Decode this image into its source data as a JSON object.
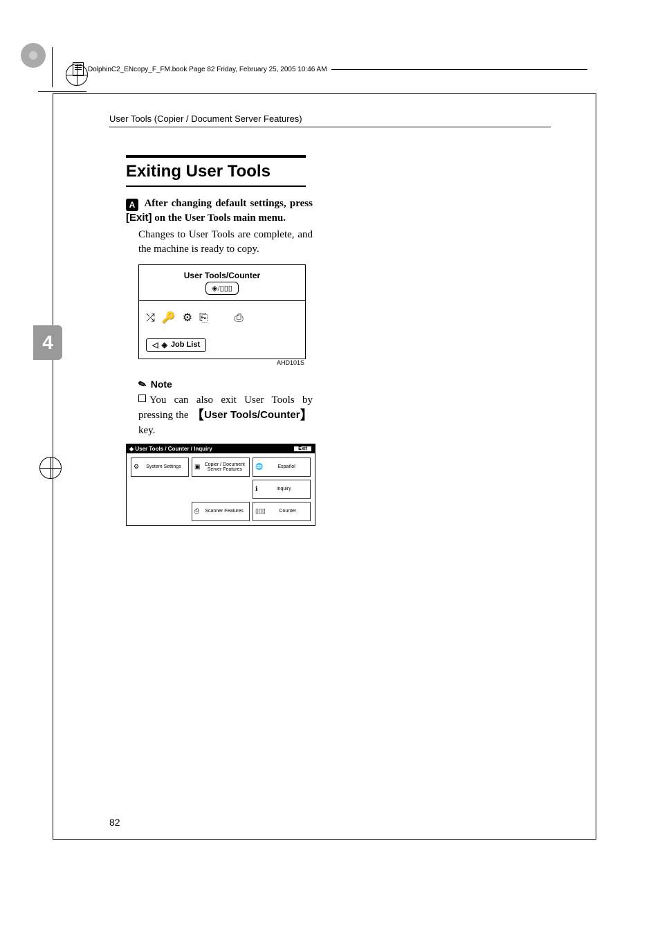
{
  "bookinfo": "DolphinC2_ENcopy_F_FM.book  Page 82  Friday, February 25, 2005  10:46 AM",
  "header": "User Tools (Copier / Document Server Features)",
  "tab_number": "4",
  "section_title": "Exiting User Tools",
  "step": {
    "badge": "A",
    "text_before": "After changing default settings, press ",
    "key": "[Exit]",
    "text_after": " on the User Tools main menu."
  },
  "para1": "Changes to User Tools are complete, and the machine is ready to copy.",
  "panel": {
    "lcd_title": "User Tools/Counter",
    "lcd_icon": "◈/▯▯▯",
    "joblist": "Job List"
  },
  "caption1": "AHD101S",
  "note_heading": "Note",
  "note_text_before": "You can also exit User Tools by pressing the ",
  "note_key": "User Tools/Counter",
  "note_text_after": " key.",
  "soft": {
    "title": "User Tools / Counter / Inquiry",
    "exit": "Exit",
    "cells": {
      "system": "System Settings",
      "copier": "Copier / Document Server Features",
      "lang": "Español",
      "scanner": "Scanner Features",
      "inquiry": "Inquiry",
      "counter": "Counter"
    }
  },
  "page_number": "82"
}
